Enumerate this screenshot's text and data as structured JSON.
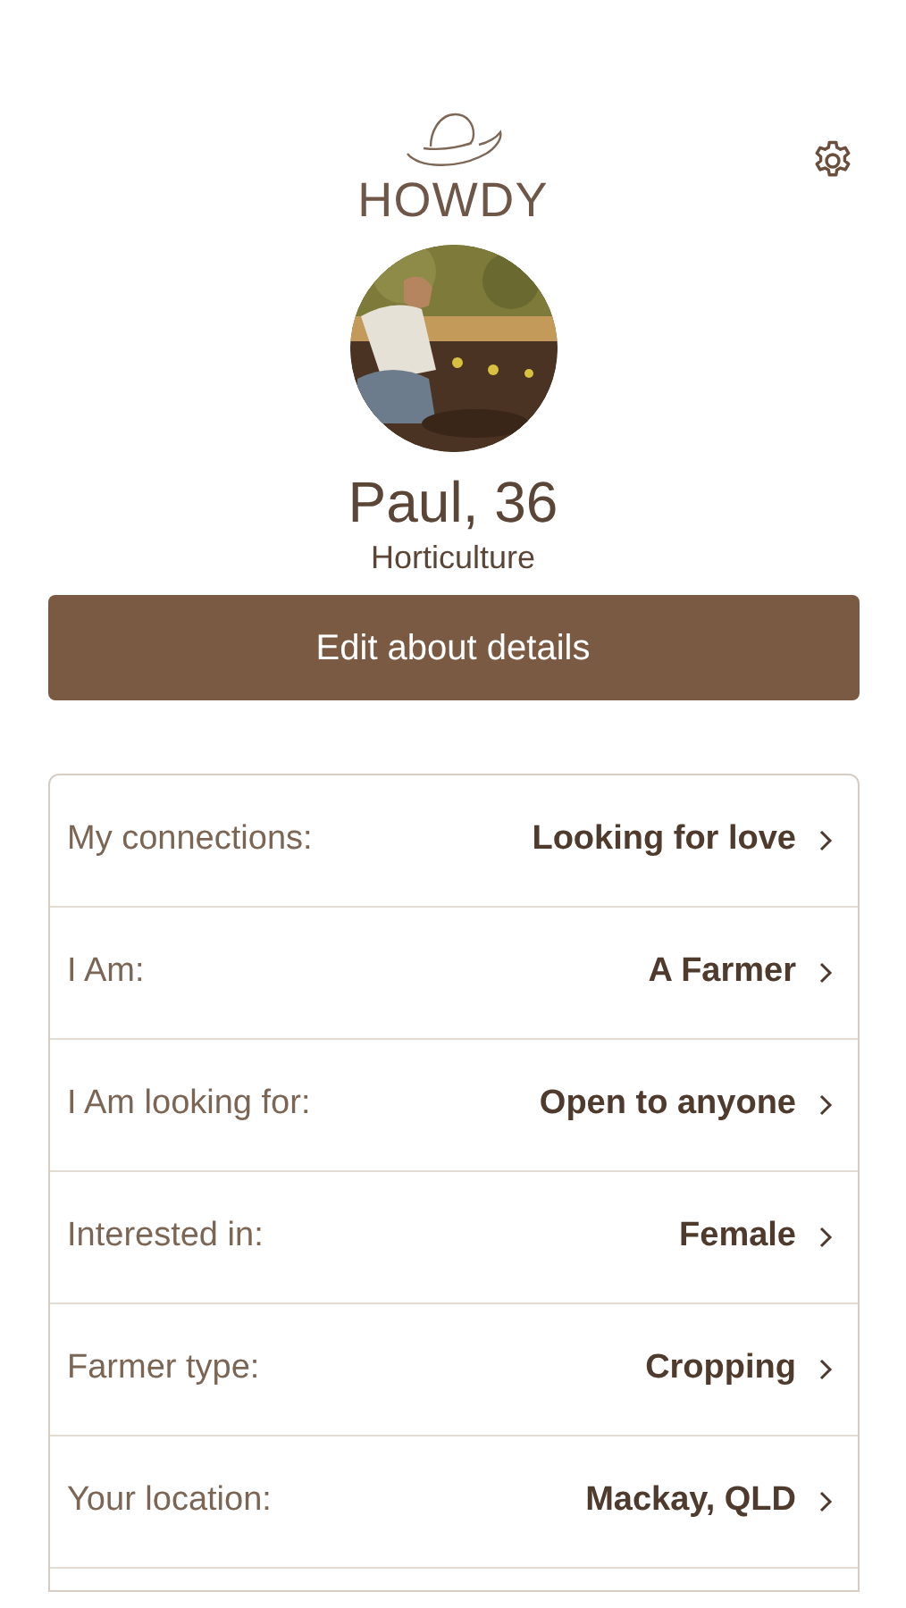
{
  "logo": {
    "text": "HOWDY"
  },
  "profile": {
    "name": "Paul, 36",
    "occupation": "Horticulture"
  },
  "edit_button": {
    "label": "Edit about details"
  },
  "details": [
    {
      "label": "My connections:",
      "value": "Looking for love"
    },
    {
      "label": "I Am:",
      "value": "A Farmer"
    },
    {
      "label": "I Am looking for:",
      "value": "Open to anyone"
    },
    {
      "label": "Interested in:",
      "value": "Female"
    },
    {
      "label": "Farmer type:",
      "value": "Cropping"
    },
    {
      "label": "Your location:",
      "value": "Mackay, QLD"
    }
  ]
}
